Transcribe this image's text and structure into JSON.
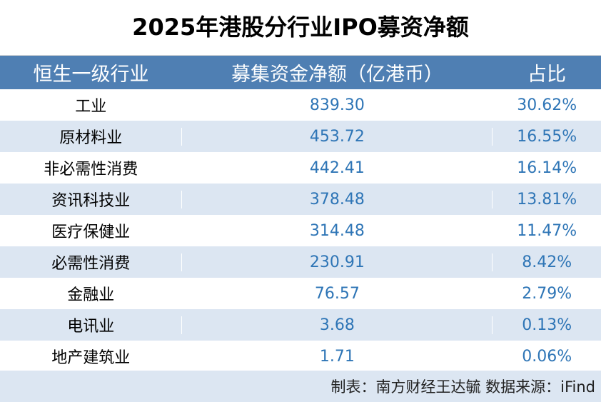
{
  "chart_data": {
    "type": "table",
    "title": "2025年港股分行业IPO募资净额",
    "columns": [
      "恒生一级行业",
      "募集资金净额（亿港币）",
      "占比"
    ],
    "rows": [
      [
        "工业",
        "839.30",
        "30.62%"
      ],
      [
        "原材料业",
        "453.72",
        "16.55%"
      ],
      [
        "非必需性消费",
        "442.41",
        "16.14%"
      ],
      [
        "资讯科技业",
        "378.48",
        "13.81%"
      ],
      [
        "医疗保健业",
        "314.48",
        "11.47%"
      ],
      [
        "必需性消费",
        "230.91",
        "8.42%"
      ],
      [
        "金融业",
        "76.57",
        "2.79%"
      ],
      [
        "电讯业",
        "3.68",
        "0.13%"
      ],
      [
        "地产建筑业",
        "1.71",
        "0.06%"
      ]
    ],
    "footnote": "制表：南方财经王达毓 数据来源：iFind"
  },
  "colors": {
    "header_bg": "#4f7fb3",
    "alt_row_bg": "#dce6f2",
    "value_text": "#2e75b6"
  }
}
